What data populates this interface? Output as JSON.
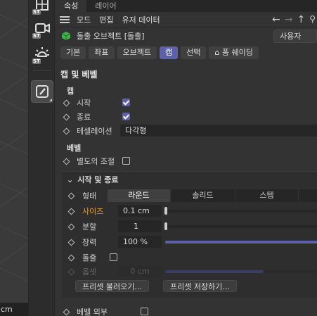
{
  "viewport": {
    "status_text": "cm"
  },
  "tabs": [
    {
      "label": "속성"
    },
    {
      "label": "레이어"
    }
  ],
  "menubar": {
    "items": [
      "모드",
      "편집",
      "유저 데이터"
    ]
  },
  "object": {
    "name": "돌출 오브젝트 [돌출]",
    "mode_label": "사용자"
  },
  "subtabs": [
    "기본",
    "좌표",
    "오브젝트",
    "캡",
    "선택",
    "퐁 쉐이딩"
  ],
  "active_subtab": "캡",
  "section_title": "캡 및 베벨",
  "cap": {
    "group_title": "캡",
    "start_label": "시작",
    "start_checked": true,
    "end_label": "종료",
    "end_checked": true,
    "tessellation_label": "테셀레이션",
    "tessellation_value": "다각형"
  },
  "bevel": {
    "group_title": "베벨",
    "separate_label": "별도의 조절",
    "separate_checked": false
  },
  "start_end": {
    "group_title": "시작 및 종료",
    "shape_label": "형태",
    "shape_options": [
      "라운드",
      "솔리드",
      "스텝",
      ""
    ],
    "shape_selected": "라운드",
    "size_label": "사이즈",
    "size_value": "0.1 cm",
    "subdiv_label": "분할",
    "subdiv_value": "1",
    "tension_label": "장력",
    "tension_value": "100 %",
    "tension_fraction": 1.0,
    "extrude_label": "돌출",
    "extrude_checked": false,
    "offset_label": "옵셋",
    "offset_value": "0 cm",
    "preset_load_label": "프리셋 불러오기...",
    "preset_save_label": "프리셋 저장하기..."
  },
  "bevel_outside": {
    "label": "베벨 외부",
    "checked": false
  },
  "colors": {
    "accent": "#5d62a8",
    "highlight_label": "#f0a030"
  }
}
